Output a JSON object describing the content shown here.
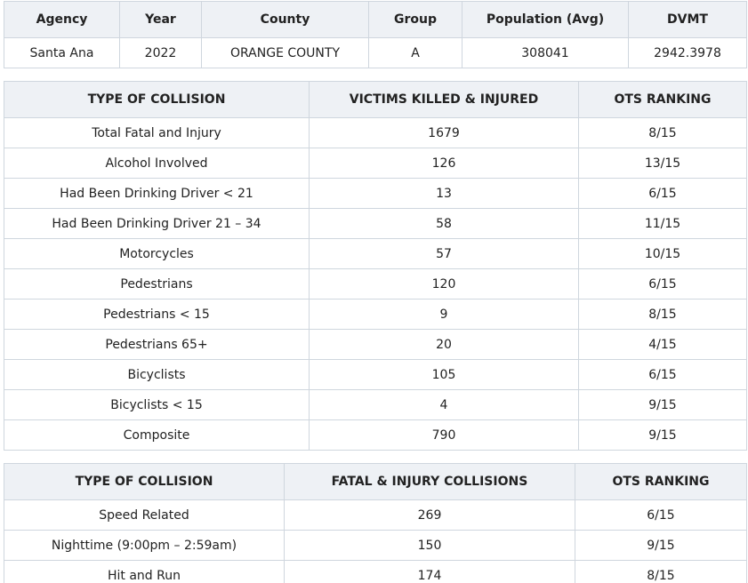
{
  "agency_table": {
    "headers": [
      "Agency",
      "Year",
      "County",
      "Group",
      "Population (Avg)",
      "DVMT"
    ],
    "row": [
      "Santa Ana",
      "2022",
      "ORANGE COUNTY",
      "A",
      "308041",
      "2942.3978"
    ]
  },
  "victims_table": {
    "headers": [
      "TYPE OF COLLISION",
      "VICTIMS KILLED & INJURED",
      "OTS RANKING"
    ],
    "rows": [
      [
        "Total Fatal and Injury",
        "1679",
        "8/15"
      ],
      [
        "Alcohol Involved",
        "126",
        "13/15"
      ],
      [
        "Had Been Drinking Driver < 21",
        "13",
        "6/15"
      ],
      [
        "Had Been Drinking Driver 21 – 34",
        "58",
        "11/15"
      ],
      [
        "Motorcycles",
        "57",
        "10/15"
      ],
      [
        "Pedestrians",
        "120",
        "6/15"
      ],
      [
        "Pedestrians < 15",
        "9",
        "8/15"
      ],
      [
        "Pedestrians 65+",
        "20",
        "4/15"
      ],
      [
        "Bicyclists",
        "105",
        "6/15"
      ],
      [
        "Bicyclists < 15",
        "4",
        "9/15"
      ],
      [
        "Composite",
        "790",
        "9/15"
      ]
    ]
  },
  "collisions_table": {
    "headers": [
      "TYPE OF COLLISION",
      "FATAL & INJURY COLLISIONS",
      "OTS RANKING"
    ],
    "rows": [
      [
        "Speed Related",
        "269",
        "6/15"
      ],
      [
        "Nighttime (9:00pm – 2:59am)",
        "150",
        "9/15"
      ],
      [
        "Hit and Run",
        "174",
        "8/15"
      ]
    ]
  }
}
